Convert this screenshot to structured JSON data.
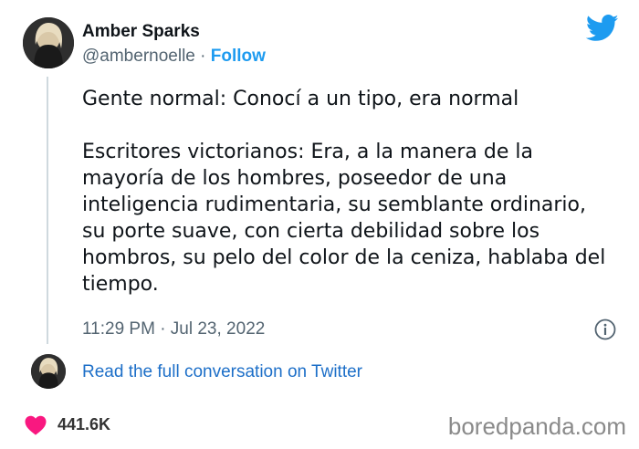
{
  "author": {
    "name": "Amber Sparks",
    "handle": "@ambernoelle",
    "separator": " · ",
    "follow_label": "Follow"
  },
  "tweet": {
    "paragraph1": "Gente normal: Conocí a un tipo, era normal",
    "paragraph2": "Escritores victorianos: Era, a la manera de la mayoría de los hombres, poseedor de una inteligencia rudimentaria, su semblante ordinario, su porte suave, con cierta debilidad sobre los hombros, su pelo del color de la ceniza, hablaba del tiempo.",
    "timestamp": "11:29 PM · Jul 23, 2022"
  },
  "footer": {
    "read_link": "Read the full conversation on Twitter",
    "like_count": "441.6K",
    "watermark": "boredpanda.com"
  },
  "icons": {
    "brand": "twitter-bird-icon",
    "info": "info-icon",
    "like": "heart-icon"
  },
  "colors": {
    "accent": "#1d9bf0",
    "link": "#1d6fc8",
    "heart": "#f91880",
    "muted": "#536471"
  }
}
